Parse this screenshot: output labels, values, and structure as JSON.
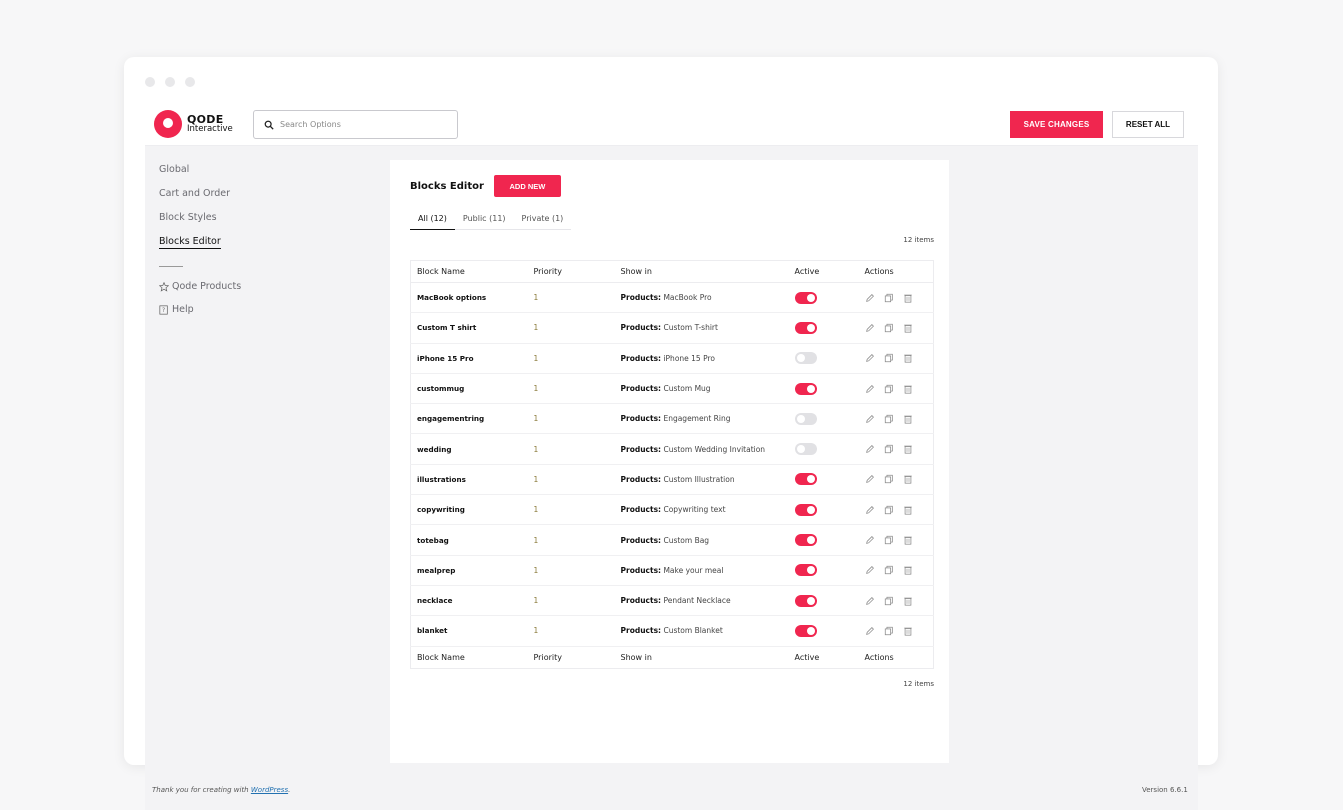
{
  "header": {
    "logo_line1": "QODE",
    "logo_line2": "Interactive",
    "search_placeholder": "Search Options",
    "save_label": "SAVE CHANGES",
    "reset_label": "RESET ALL"
  },
  "sidebar": {
    "items": [
      {
        "label": "Global"
      },
      {
        "label": "Cart and Order"
      },
      {
        "label": "Block Styles"
      },
      {
        "label": "Blocks Editor"
      }
    ],
    "aux": [
      {
        "label": "Qode Products",
        "icon": "star-icon"
      },
      {
        "label": "Help",
        "icon": "help-icon"
      }
    ]
  },
  "panel": {
    "title": "Blocks Editor",
    "add_label": "ADD NEW",
    "tabs": [
      {
        "label": "All (12)"
      },
      {
        "label": "Public (11)"
      },
      {
        "label": "Private (1)"
      }
    ],
    "count_top": "12 items",
    "count_bottom": "12 items",
    "columns": [
      "Block Name",
      "Priority",
      "Show in",
      "Active",
      "Actions"
    ],
    "rows": [
      {
        "name": "MacBook options",
        "priority": "1",
        "show_label": "Products:",
        "show_value": "MacBook Pro",
        "active": true
      },
      {
        "name": "Custom T shirt",
        "priority": "1",
        "show_label": "Products:",
        "show_value": "Custom T-shirt",
        "active": true
      },
      {
        "name": "iPhone 15 Pro",
        "priority": "1",
        "show_label": "Products:",
        "show_value": "iPhone 15 Pro",
        "active": false
      },
      {
        "name": "custommug",
        "priority": "1",
        "show_label": "Products:",
        "show_value": "Custom Mug",
        "active": true
      },
      {
        "name": "engagementring",
        "priority": "1",
        "show_label": "Products:",
        "show_value": "Engagement Ring",
        "active": false
      },
      {
        "name": "wedding",
        "priority": "1",
        "show_label": "Products:",
        "show_value": "Custom Wedding Invitation",
        "active": false
      },
      {
        "name": "illustrations",
        "priority": "1",
        "show_label": "Products:",
        "show_value": "Custom Illustration",
        "active": true
      },
      {
        "name": "copywriting",
        "priority": "1",
        "show_label": "Products:",
        "show_value": "Copywriting text",
        "active": true
      },
      {
        "name": "totebag",
        "priority": "1",
        "show_label": "Products:",
        "show_value": "Custom Bag",
        "active": true
      },
      {
        "name": "mealprep",
        "priority": "1",
        "show_label": "Products:",
        "show_value": "Make your meal",
        "active": true
      },
      {
        "name": "necklace",
        "priority": "1",
        "show_label": "Products:",
        "show_value": "Pendant Necklace",
        "active": true
      },
      {
        "name": "blanket",
        "priority": "1",
        "show_label": "Products:",
        "show_value": "Custom Blanket",
        "active": true
      }
    ]
  },
  "footer": {
    "thanks_prefix": "Thank you for creating with",
    "thanks_link": "WordPress",
    "thanks_suffix": ".",
    "version": "Version 6.6.1"
  },
  "colors": {
    "accent": "#f0264f",
    "toggle_off": "#e1e1e4"
  }
}
